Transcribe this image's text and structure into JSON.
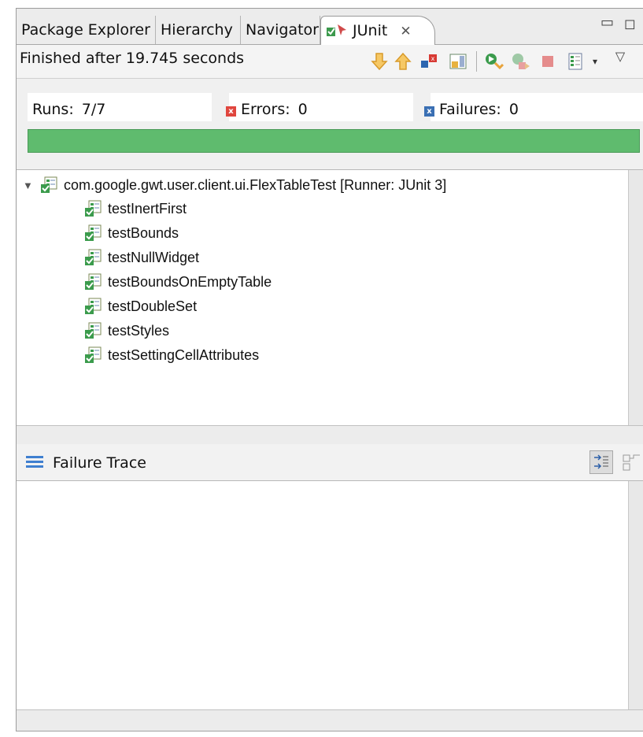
{
  "tabs": [
    {
      "label": "Package Explorer"
    },
    {
      "label": "Hierarchy"
    },
    {
      "label": "Navigator"
    },
    {
      "label": "JUnit",
      "active": true
    }
  ],
  "toolbar": {
    "status": "Finished after 19.745 seconds",
    "icons": [
      "next-failure-icon",
      "previous-failure-icon",
      "show-failures-only-icon",
      "scroll-lock-icon",
      "rerun-test-icon",
      "rerun-failed-first-icon",
      "stop-icon",
      "test-run-history-icon",
      "view-menu-icon"
    ]
  },
  "counters": {
    "runs_label": "Runs:",
    "runs_value": "7/7",
    "errors_label": "Errors:",
    "errors_value": "0",
    "failures_label": "Failures:",
    "failures_value": "0",
    "progress": 1.0
  },
  "tree": {
    "suite": "com.google.gwt.user.client.ui.FlexTableTest [Runner: JUnit 3]",
    "tests": [
      "testInertFirst",
      "testBounds",
      "testNullWidget",
      "testBoundsOnEmptyTable",
      "testDoubleSet",
      "testStyles",
      "testSettingCellAttributes"
    ]
  },
  "trace": {
    "title": "Failure Trace"
  },
  "colors": {
    "progress_ok": "#5fbb6e",
    "error_badge": "#e0463e",
    "failure_badge": "#3a6fb3"
  }
}
